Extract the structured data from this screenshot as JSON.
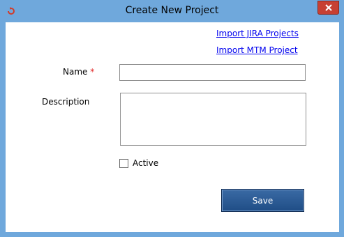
{
  "window": {
    "title": "Create New Project"
  },
  "links": {
    "import_jira": "Import JIRA Projects",
    "import_mtm": "Import MTM Project"
  },
  "form": {
    "name_label": "Name",
    "required_marker": "*",
    "name_value": "",
    "description_label": "Description",
    "description_value": "",
    "active_label": "Active",
    "active_checked": false
  },
  "buttons": {
    "save_label": "Save"
  },
  "colors": {
    "frame": "#6fa8dc",
    "close_button": "#c74032",
    "link": "#0000ee",
    "save_button": "#1f4d86",
    "required": "#e02020"
  }
}
